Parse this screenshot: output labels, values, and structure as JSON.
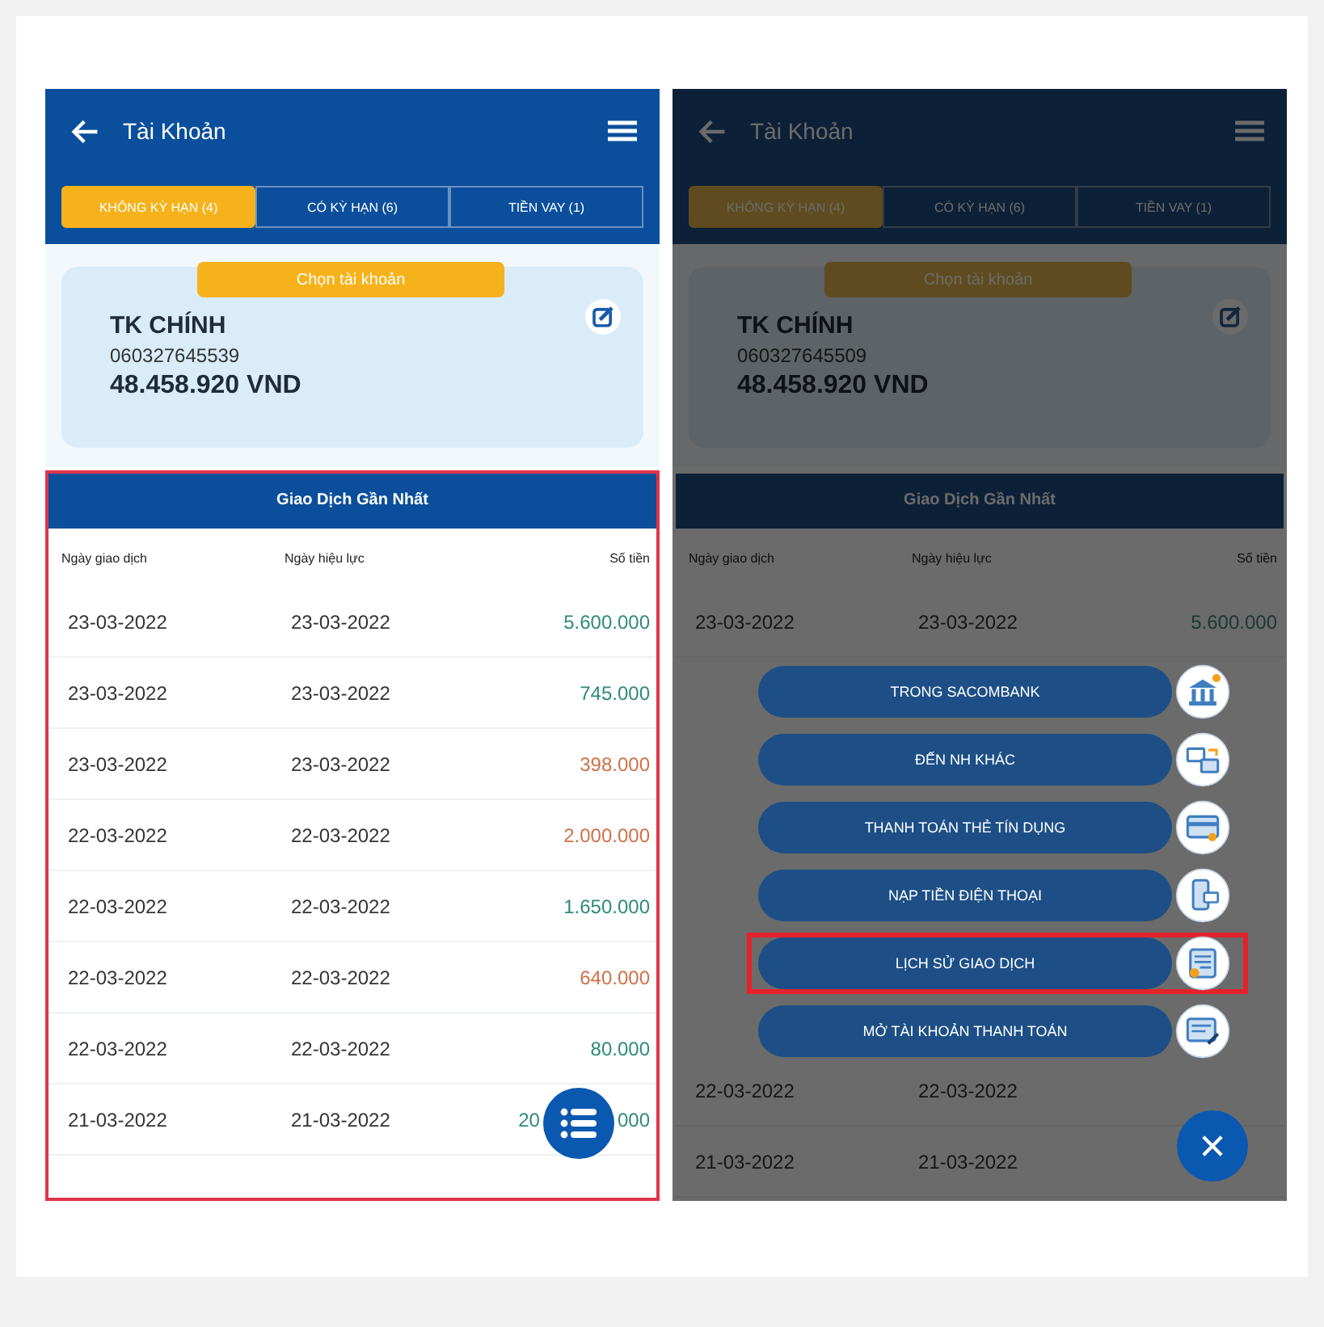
{
  "screens": [
    {
      "dimmed": false,
      "header": {
        "title": "Tài Khoản"
      },
      "tabs": [
        {
          "label": "KHÔNG KỲ HẠN (4)",
          "selected": true
        },
        {
          "label": "CÓ KỲ HẠN (6)",
          "selected": false
        },
        {
          "label": "TIỀN VAY (1)",
          "selected": false
        }
      ],
      "card": {
        "button": "Chọn tài khoản",
        "name": "TK CHÍNH",
        "number": "060327645539",
        "balance": "48.458.920 VND"
      },
      "table": {
        "title": "Giao Dịch Gần Nhất",
        "highlighted": true,
        "columns": [
          "Ngày giao dịch",
          "Ngày hiệu lực",
          "Số tiền"
        ],
        "rows": [
          {
            "date": "23-03-2022",
            "effective": "23-03-2022",
            "amount": [
              "5.600.000"
            ],
            "kind": "credit"
          },
          {
            "date": "23-03-2022",
            "effective": "23-03-2022",
            "amount": [
              "745.000"
            ],
            "kind": "credit"
          },
          {
            "date": "23-03-2022",
            "effective": "23-03-2022",
            "amount": [
              "398.000"
            ],
            "kind": "debit"
          },
          {
            "date": "22-03-2022",
            "effective": "22-03-2022",
            "amount": [
              "2.000.000"
            ],
            "kind": "debit"
          },
          {
            "date": "22-03-2022",
            "effective": "22-03-2022",
            "amount": [
              "1.650.000"
            ],
            "kind": "credit"
          },
          {
            "date": "22-03-2022",
            "effective": "22-03-2022",
            "amount": [
              "640.000"
            ],
            "kind": "debit"
          },
          {
            "date": "22-03-2022",
            "effective": "22-03-2022",
            "amount": [
              "80.000"
            ],
            "kind": "credit"
          },
          {
            "date": "21-03-2022",
            "effective": "21-03-2022",
            "amount": [
              "20",
              "000"
            ],
            "kind": "credit"
          }
        ]
      },
      "fab": {
        "kind": "list"
      }
    },
    {
      "dimmed": true,
      "header": {
        "title": "Tài Khoản"
      },
      "tabs": [
        {
          "label": "KHÔNG KỲ HẠN (4)",
          "selected": true
        },
        {
          "label": "CÓ KỲ HẠN (6)",
          "selected": false
        },
        {
          "label": "TIỀN VAY (1)",
          "selected": false
        }
      ],
      "card": {
        "button": "Chọn tài khoản",
        "name": "TK CHÍNH",
        "number": "060327645509",
        "balance": "48.458.920 VND"
      },
      "table": {
        "title": "Giao Dịch Gần Nhất",
        "highlighted": false,
        "columns": [
          "Ngày giao dịch",
          "Ngày hiệu lực",
          "Số tiền"
        ],
        "rows": [
          {
            "date": "23-03-2022",
            "effective": "23-03-2022",
            "amount": [
              "5.600.000"
            ],
            "kind": "credit"
          },
          {
            "date": "22-03-2022",
            "effective": "22-03-2022",
            "amount": []
          },
          {
            "date": "21-03-2022",
            "effective": "21-03-2022",
            "amount": []
          }
        ]
      },
      "menu": [
        {
          "label": "TRONG SACOMBANK",
          "highlighted": false,
          "kind": "bank"
        },
        {
          "label": "ĐẾN NH KHÁC",
          "highlighted": false,
          "kind": "transfer"
        },
        {
          "label": "THANH TOÁN THẺ TÍN DỤNG",
          "highlighted": false,
          "kind": "card"
        },
        {
          "label": "NẠP TIỀN ĐIỆN THOẠI",
          "highlighted": false,
          "kind": "phone"
        },
        {
          "label": "LỊCH SỬ GIAO DỊCH",
          "highlighted": true,
          "kind": "history"
        },
        {
          "label": "MỞ TÀI KHOẢN THANH TOÁN",
          "highlighted": false,
          "kind": "account"
        }
      ],
      "fab": {
        "kind": "close"
      }
    }
  ]
}
